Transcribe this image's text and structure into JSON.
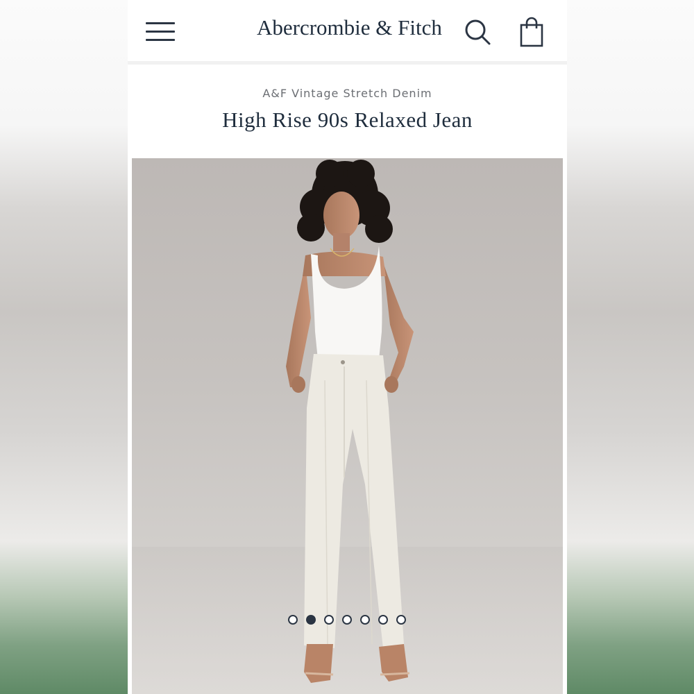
{
  "header": {
    "brand": "Abercrombie & Fitch",
    "menu_icon": "hamburger-menu-icon",
    "search_icon": "search-icon",
    "bag_icon": "shopping-bag-icon"
  },
  "product": {
    "collection": "A&F Vintage Stretch Denim",
    "title": "High Rise 90s Relaxed Jean"
  },
  "carousel": {
    "total_images": 7,
    "active_index": 2
  },
  "colors": {
    "brand_navy": "#1f2d3d",
    "subtitle_gray": "#6b6e73",
    "photo_background": "#c6c2bf"
  }
}
